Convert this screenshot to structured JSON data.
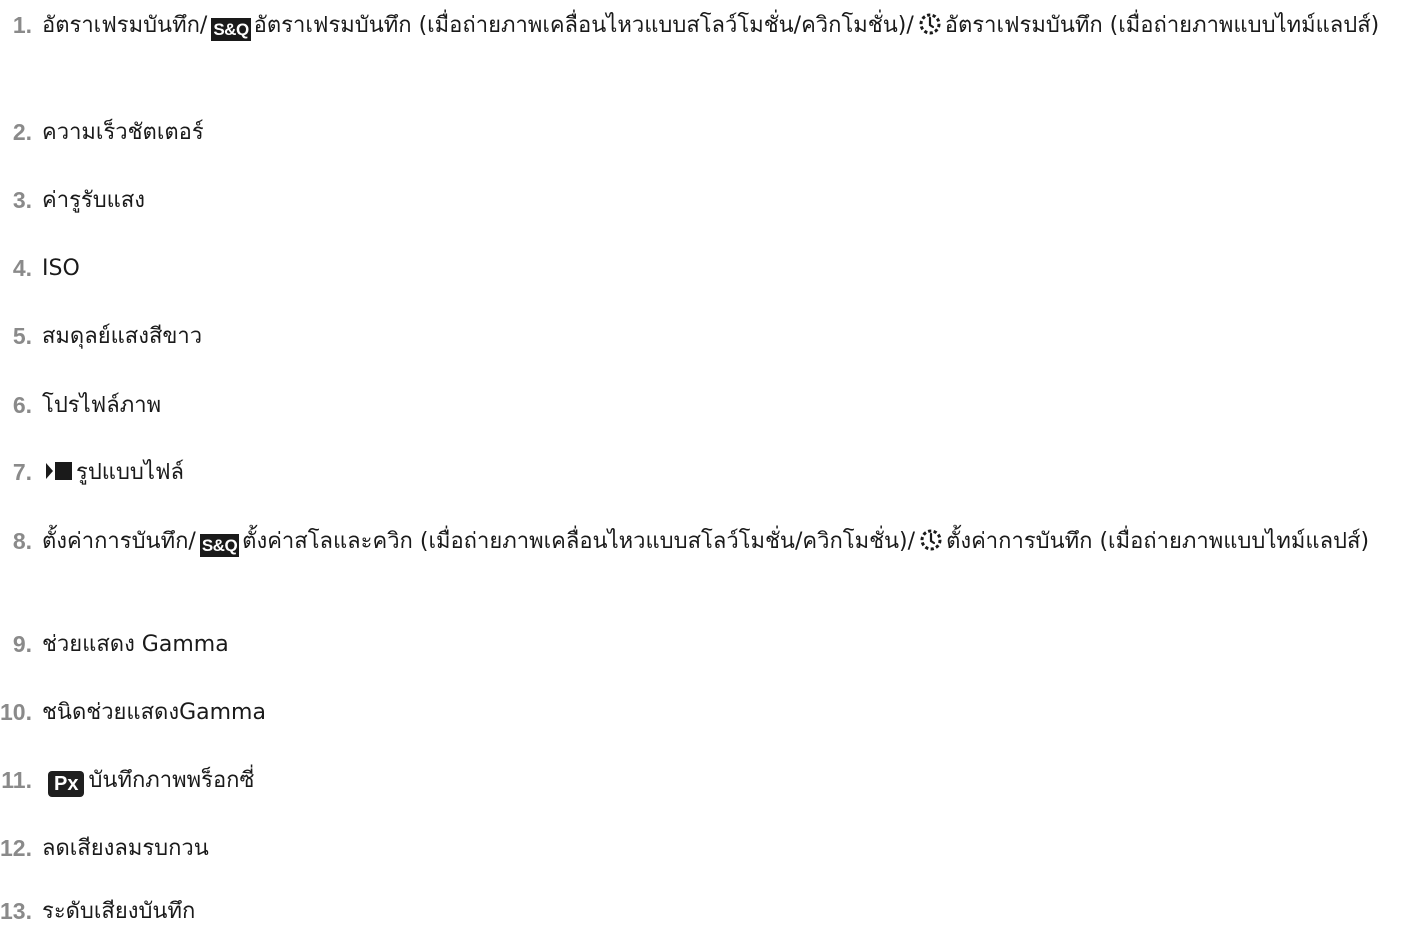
{
  "items": [
    {
      "number": "1.",
      "parts": {
        "a": "อัตราเฟรมบันทึก/",
        "sq_icon": "S&Q",
        "b": "อัตราเฟรมบันทึก (เมื่อถ่ายภาพเคลื่อนไหวแบบสโลว์โมชั่น/ควิกโมชั่น)/",
        "c": "อัตราเฟรมบันทึก (เมื่อถ่ายภาพแบบไทม์แลปส์)"
      }
    },
    {
      "number": "2.",
      "text": "ความเร็วชัตเตอร์"
    },
    {
      "number": "3.",
      "text": "ค่ารูรับแสง"
    },
    {
      "number": "4.",
      "text": "ISO"
    },
    {
      "number": "5.",
      "text": "สมดุลย์แสงสีขาว"
    },
    {
      "number": "6.",
      "text": "โปรไฟล์ภาพ"
    },
    {
      "number": "7.",
      "text": "รูปแบบไฟล์",
      "icon": "movie-icon"
    },
    {
      "number": "8.",
      "parts": {
        "a": "ตั้งค่าการบันทึก/",
        "sq_icon": "S&Q",
        "b": "ตั้งค่าสโลและควิก (เมื่อถ่ายภาพเคลื่อนไหวแบบสโลว์โมชั่น/ควิกโมชั่น)/",
        "c": "ตั้งค่าการบันทึก (เมื่อถ่ายภาพแบบไทม์แลปส์)"
      }
    },
    {
      "number": "9.",
      "text": "ช่วยแสดง Gamma"
    },
    {
      "number": "10.",
      "text": "ชนิดช่วยแสดงGamma"
    },
    {
      "number": "11.",
      "text": "บันทึกภาพพร็อกซี่",
      "badge": "Px"
    },
    {
      "number": "12.",
      "text": "ลดเสียงลมรบกวน"
    },
    {
      "number": "13.",
      "text": "ระดับเสียงบันทึก"
    }
  ],
  "icons": {
    "sq": "sq-icon",
    "timelapse": "timelapse-icon",
    "movie": "movie-icon",
    "proxy": "proxy-icon"
  },
  "colors": {
    "number": "#8a8a8a",
    "text": "#1a1a1a",
    "icon_bg": "#1a1a1a"
  }
}
